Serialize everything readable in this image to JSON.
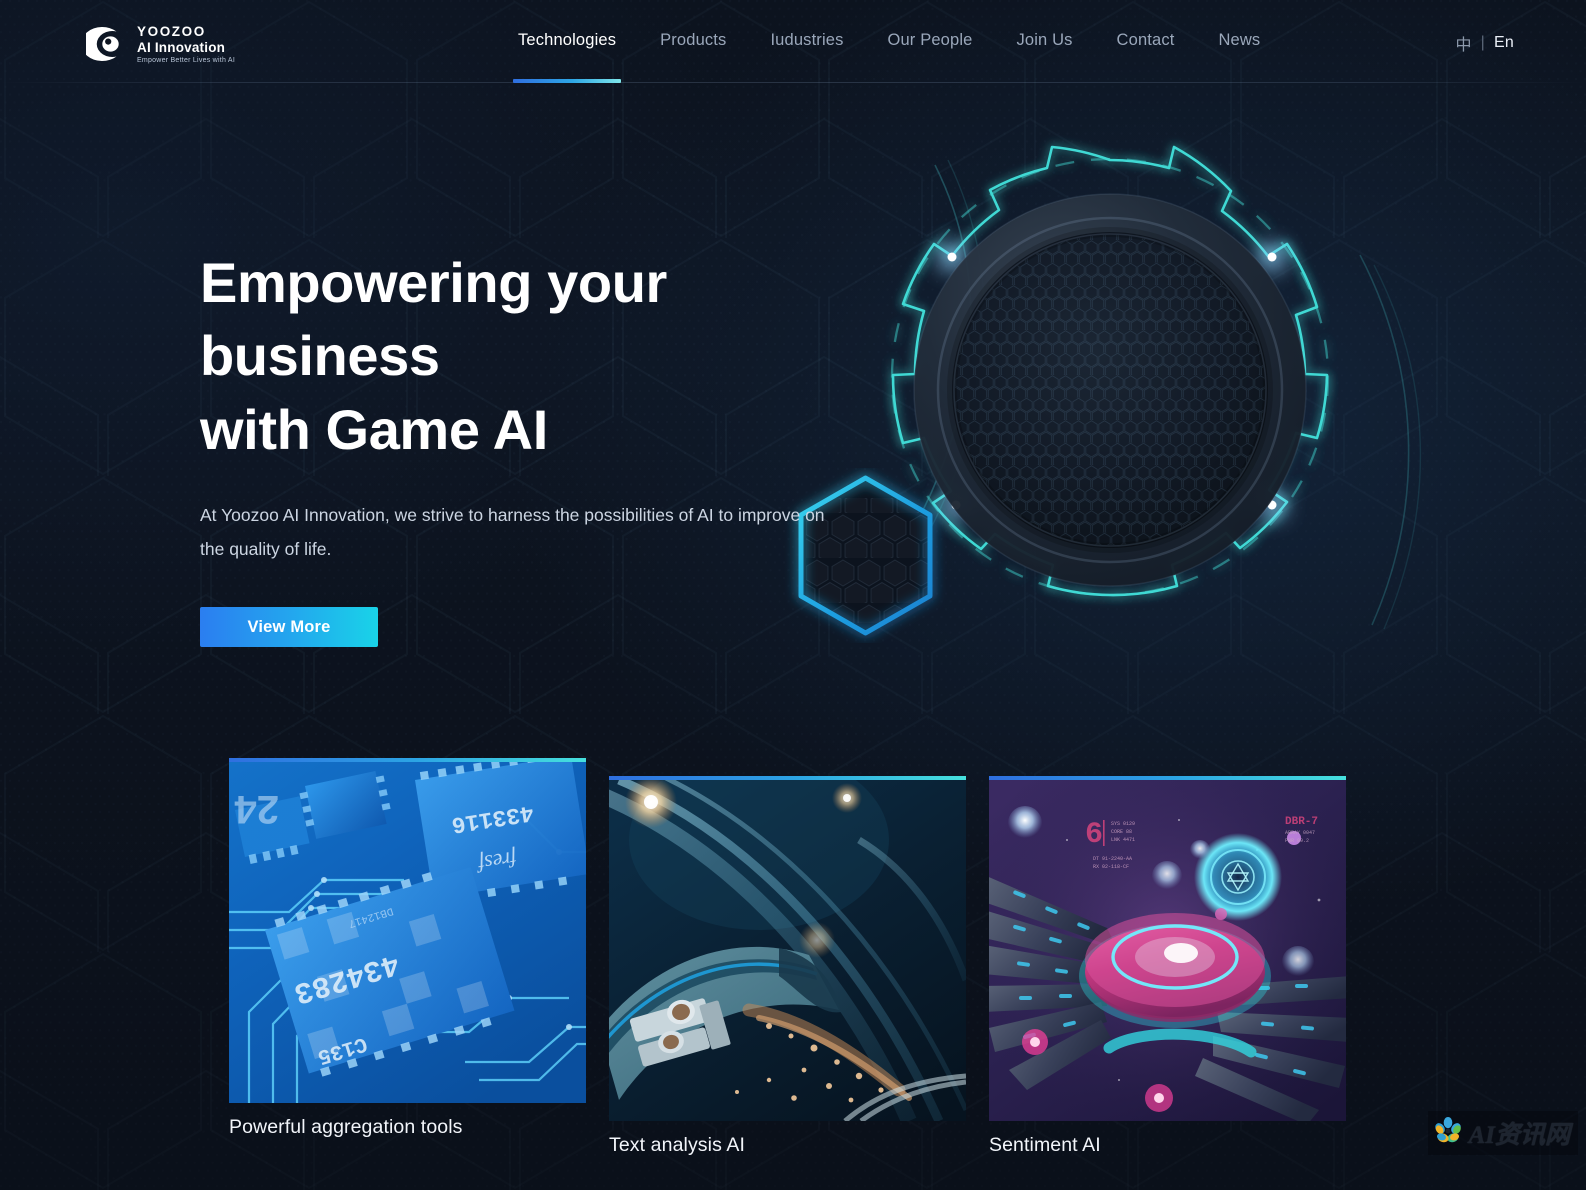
{
  "brand": {
    "logo_icon": "eye-logo-icon",
    "name_line1": "YOOZOO",
    "name_line2": "AI Innovation",
    "tagline": "Empower Better Lives with AI"
  },
  "nav": {
    "items": [
      {
        "label": "Technologies",
        "active": true
      },
      {
        "label": "Products",
        "active": false
      },
      {
        "label": "Iudustries",
        "active": false
      },
      {
        "label": "Our People",
        "active": false
      },
      {
        "label": "Join Us",
        "active": false
      },
      {
        "label": "Contact",
        "active": false
      },
      {
        "label": "News",
        "active": false
      }
    ],
    "lang": {
      "zh": "中",
      "separator": "|",
      "en": "En",
      "active": "En"
    }
  },
  "hero": {
    "title_line1": "Empowering your business",
    "title_line2": "with Game AI",
    "subtitle": "At Yoozoo AI Innovation, we strive to harness the possibilities of AI to improve on the quality of life.",
    "cta_label": "View More",
    "art": {
      "gear_icon": "gear-ring-icon",
      "hub_icon": "honeycomb-hub-icon",
      "hexagon_icon": "glowing-hexagon-icon",
      "glow_nodes": 4
    }
  },
  "cards": [
    {
      "title": "Powerful aggregation tools",
      "image_alt": "blue-circuit-board-microchips",
      "accent_from": "#2f6fe0",
      "accent_to": "#46e0dd"
    },
    {
      "title": "Text analysis AI",
      "image_alt": "teal-metallic-tech-abstract",
      "accent_from": "#2f6fe0",
      "accent_to": "#46e0dd"
    },
    {
      "title": "Sentiment AI",
      "image_alt": "purple-sci-fi-spacecraft-portal",
      "accent_from": "#2f6fe0",
      "accent_to": "#46e0dd"
    }
  ],
  "watermark": {
    "text": "AI资讯网",
    "icon": "flower-pinwheel-icon"
  },
  "colors": {
    "background": "#0d1420",
    "accent_blue": "#2b7ef0",
    "accent_cyan": "#19d3e8",
    "text_primary": "#ffffff",
    "text_muted": "#9aa7ba"
  }
}
